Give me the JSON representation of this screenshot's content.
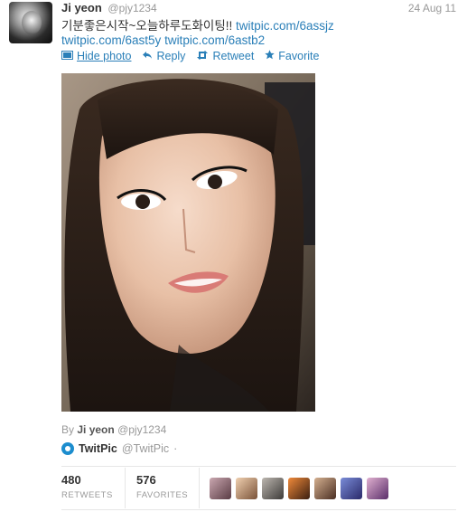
{
  "tweet": {
    "name": "Ji yeon",
    "handle": "@pjy1234",
    "date": "24 Aug 11",
    "text_prefix": "기분좋은시작~오늘하루도화이팅!! ",
    "link1": "twitpic.com/6assjz",
    "link2": "twitpic.com/6ast5y",
    "link3": "twitpic.com/6astb2"
  },
  "actions": {
    "hide_photo": "Hide photo",
    "reply": "Reply",
    "retweet": "Retweet",
    "favorite": "Favorite"
  },
  "attribution": {
    "by_label": "By",
    "name": "Ji yeon",
    "handle": "@pjy1234"
  },
  "service": {
    "name": "TwitPic",
    "handle": "@TwitPic",
    "dot": "·"
  },
  "stats": {
    "retweets_count": "480",
    "retweets_label": "RETWEETS",
    "favorites_count": "576",
    "favorites_label": "FAVORITES"
  },
  "colors": {
    "link": "#2a7fb8",
    "muted": "#999999",
    "text": "#333333"
  }
}
